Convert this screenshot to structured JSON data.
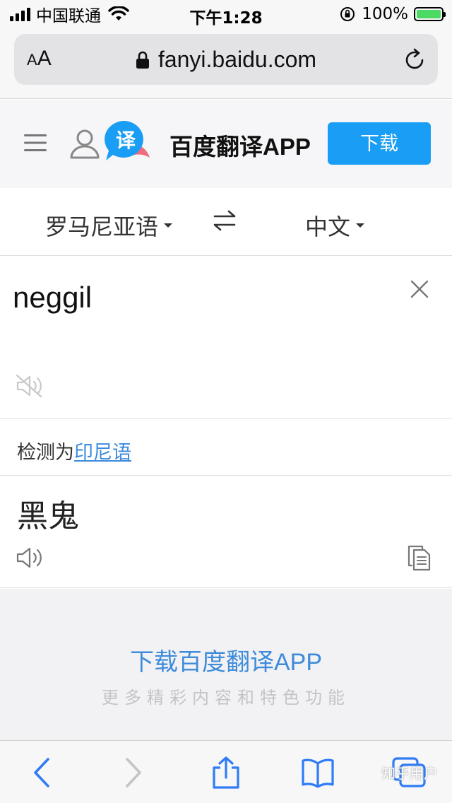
{
  "status_bar": {
    "carrier": "中国联通",
    "time": "下午1:28",
    "battery_percent": "100%",
    "battery_level": 1.0,
    "icons": [
      "signal-icon",
      "wifi-icon",
      "orientation-lock-icon",
      "battery-charging-icon"
    ]
  },
  "browser": {
    "text_size_label_small": "A",
    "text_size_label_large": "A",
    "url": "fanyi.baidu.com",
    "icons": [
      "lock-icon",
      "reload-icon"
    ]
  },
  "header": {
    "app_title": "百度翻译APP",
    "download_label": "下载",
    "logo_char": "译",
    "icons": [
      "menu-icon",
      "user-icon",
      "app-logo-icon"
    ]
  },
  "languages": {
    "source": "罗马尼亚语",
    "target": "中文",
    "icons": [
      "swap-icon",
      "caret-down-icon"
    ]
  },
  "input": {
    "text": "neggil",
    "icons": [
      "clear-icon",
      "speaker-muted-icon"
    ]
  },
  "detect": {
    "prefix": "检测为",
    "language": "印尼语"
  },
  "result": {
    "text": "黑鬼",
    "icons": [
      "speaker-icon",
      "copy-icon"
    ]
  },
  "promo": {
    "title": "下载百度翻译APP",
    "subtitle": "更多精彩内容和特色功能"
  },
  "toolbar": {
    "icons": [
      "back-icon",
      "forward-icon",
      "share-icon",
      "bookmarks-icon",
      "tabs-icon"
    ]
  },
  "watermark": "知乎用户",
  "colors": {
    "accent_blue": "#1a9df4",
    "link_blue": "#3d8bdb",
    "safari_blue": "#2f7cf6",
    "battery_green": "#4cd964"
  }
}
